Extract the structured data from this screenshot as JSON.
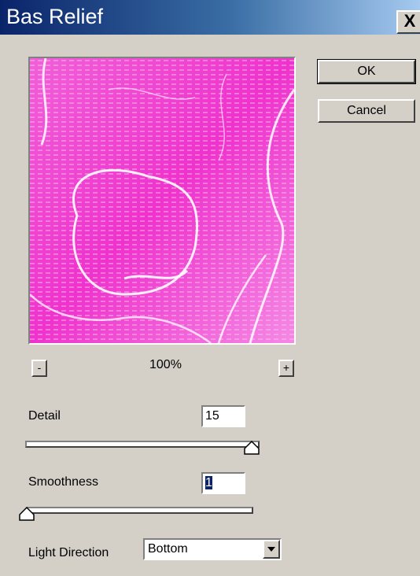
{
  "dialog": {
    "title": "Bas Relief",
    "close_label": "X"
  },
  "buttons": {
    "ok_label": "OK",
    "cancel_label": "Cancel"
  },
  "zoom": {
    "minus_label": "-",
    "plus_label": "+",
    "level": "100%"
  },
  "detail": {
    "label": "Detail",
    "value": "15",
    "slider_fraction": 1.0
  },
  "smoothness": {
    "label": "Smoothness",
    "value": "1",
    "slider_fraction": 0.0
  },
  "light_direction": {
    "label": "Light Direction",
    "selected": "Bottom"
  },
  "colors": {
    "preview_tint": "#ee33cc",
    "title_gradient_start": "#0a246a",
    "dialog_face": "#d4d0c8"
  }
}
